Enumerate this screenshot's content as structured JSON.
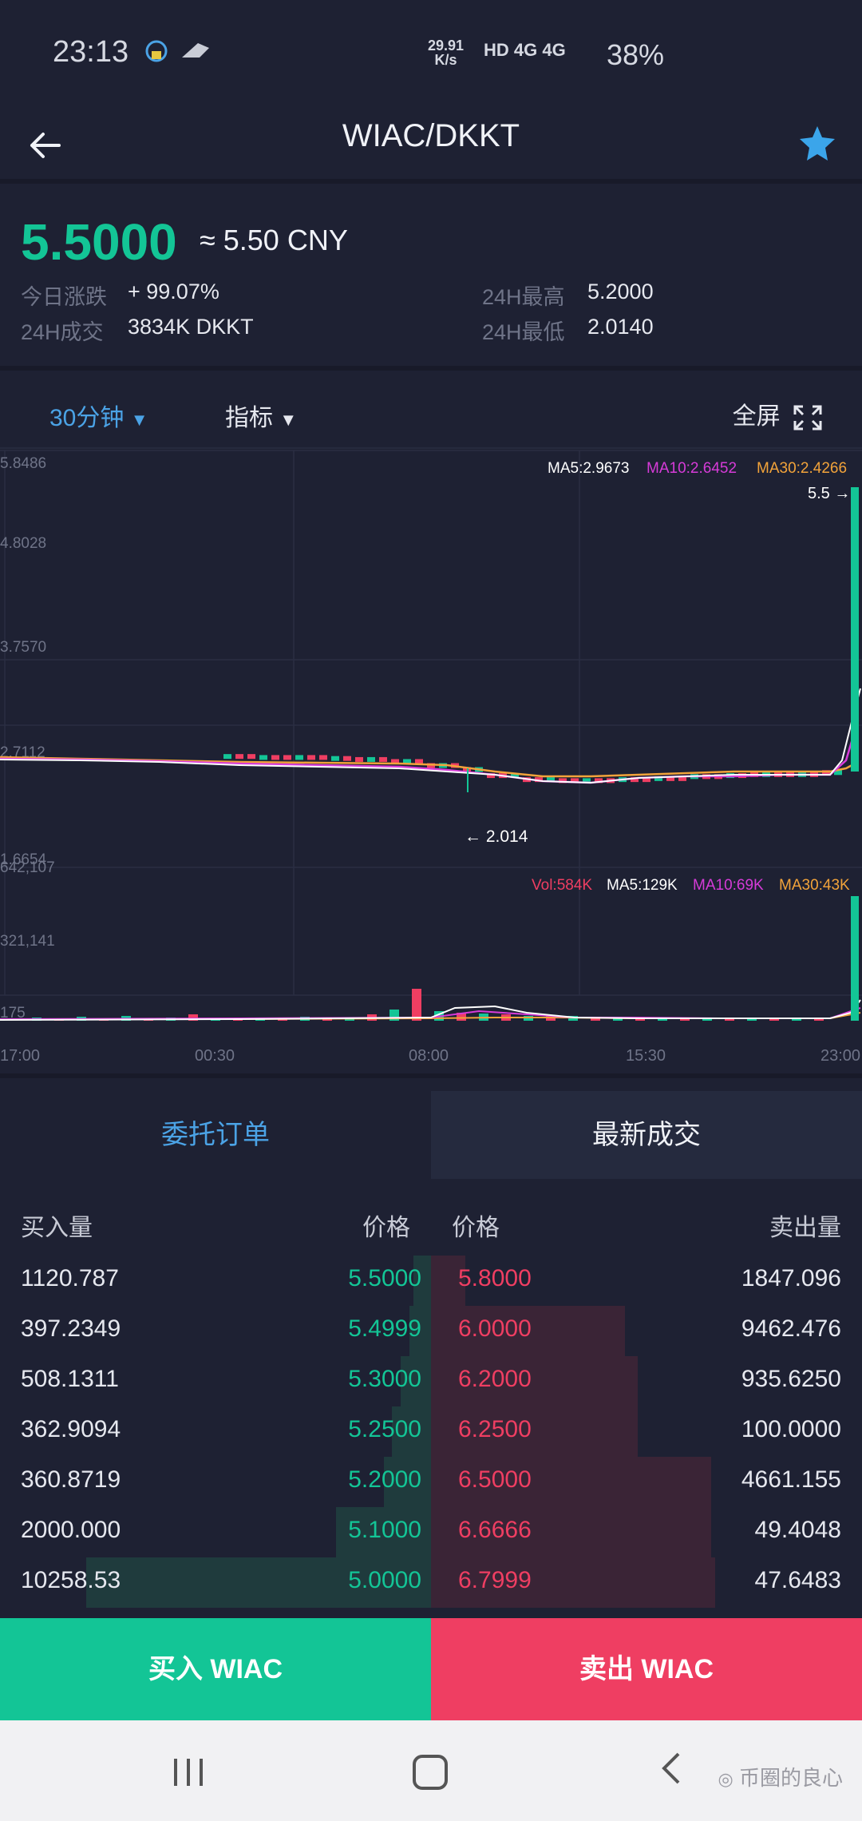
{
  "status_bar": {
    "time": "23:13",
    "speed_value": "29.91",
    "speed_unit": "K/s",
    "network": "HD 4G 4G",
    "battery": "38%"
  },
  "nav": {
    "title": "WIAC/DKKT",
    "back_icon": "arrow-left-icon",
    "favorite_icon": "star-icon"
  },
  "ticker": {
    "price": "5.5000",
    "cny": "≈ 5.50 CNY",
    "change_label": "今日涨跌",
    "change_value": "+ 99.07%",
    "volume_label": "24H成交",
    "volume_value": "3834K DKKT",
    "high_label": "24H最高",
    "high_value": "5.2000",
    "low_label": "24H最低",
    "low_value": "2.0140"
  },
  "chart_toolbar": {
    "interval": "30分钟",
    "indicator": "指标",
    "fullscreen": "全屏"
  },
  "chart_data": {
    "type": "line",
    "price_axis": [
      "5.8486",
      "4.8028",
      "3.7570",
      "2.7112",
      "1.6654"
    ],
    "ma_legend": {
      "ma5": "MA5:2.9673",
      "ma10": "MA10:2.6452",
      "ma30": "MA30:2.4266"
    },
    "last_price_label": "5.5 →",
    "low_marker": "← 2.014",
    "volume_axis": [
      "642,107",
      "321,141",
      "175"
    ],
    "vol_legend": {
      "vol": "Vol:584K",
      "ma5": "MA5:129K",
      "ma10": "MA10:69K",
      "ma30": "MA30:43K"
    },
    "time_axis": [
      "17:00",
      "00:30",
      "08:00",
      "15:30",
      "23:00"
    ],
    "close": [
      2.71,
      2.7,
      2.7,
      2.69,
      2.68,
      2.66,
      2.62,
      2.58,
      2.52,
      2.48,
      2.47,
      2.47,
      2.48,
      2.49,
      2.51,
      2.52,
      2.53,
      2.53,
      2.55,
      5.5
    ],
    "colors": {
      "up": "#13c596",
      "down": "#ef3e62",
      "ma5": "#ffffff",
      "ma10": "#d63bd8",
      "ma30": "#f2a33a"
    }
  },
  "tabs": {
    "orders": "委托订单",
    "trades": "最新成交"
  },
  "order_book": {
    "headers": {
      "buy_qty": "买入量",
      "buy_price": "价格",
      "sell_price": "价格",
      "sell_qty": "卖出量"
    },
    "rows": [
      {
        "buy_qty": "1120.787",
        "buy_price": "5.5000",
        "sell_price": "5.8000",
        "sell_qty": "1847.096",
        "buy_depth": 0.04,
        "sell_depth": 0.08
      },
      {
        "buy_qty": "397.2349",
        "buy_price": "5.4999",
        "sell_price": "6.0000",
        "sell_qty": "9462.476",
        "buy_depth": 0.05,
        "sell_depth": 0.45
      },
      {
        "buy_qty": "508.1311",
        "buy_price": "5.3000",
        "sell_price": "6.2000",
        "sell_qty": "935.6250",
        "buy_depth": 0.07,
        "sell_depth": 0.48
      },
      {
        "buy_qty": "362.9094",
        "buy_price": "5.2500",
        "sell_price": "6.2500",
        "sell_qty": "100.0000",
        "buy_depth": 0.09,
        "sell_depth": 0.48
      },
      {
        "buy_qty": "360.8719",
        "buy_price": "5.2000",
        "sell_price": "6.5000",
        "sell_qty": "4661.155",
        "buy_depth": 0.11,
        "sell_depth": 0.65
      },
      {
        "buy_qty": "2000.000",
        "buy_price": "5.1000",
        "sell_price": "6.6666",
        "sell_qty": "49.4048",
        "buy_depth": 0.22,
        "sell_depth": 0.65
      },
      {
        "buy_qty": "10258.53",
        "buy_price": "5.0000",
        "sell_price": "6.7999",
        "sell_qty": "47.6483",
        "buy_depth": 0.8,
        "sell_depth": 0.66
      }
    ]
  },
  "actions": {
    "buy": "买入 WIAC",
    "sell": "卖出 WIAC"
  },
  "system_nav": {
    "recents_icon": "recents-icon",
    "home_icon": "home-icon",
    "back_icon": "back-chevron-icon",
    "watermark": "币圈的良心"
  }
}
